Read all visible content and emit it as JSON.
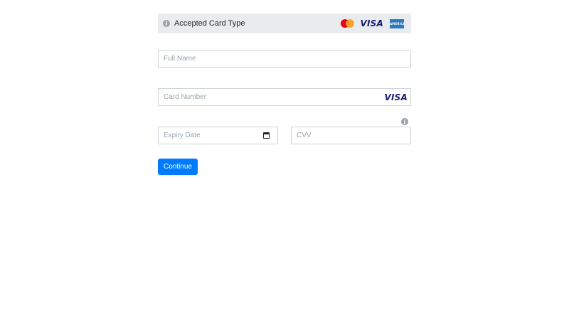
{
  "card_type_bar": {
    "label": "Accepted Card Type",
    "info_icon": "info-icon",
    "logos": {
      "mastercard": "mastercard-logo",
      "visa_text": "VISA",
      "amex_text": "AMERICAN EXPRESS"
    }
  },
  "form": {
    "full_name": {
      "placeholder": "Full Name",
      "value": ""
    },
    "card_number": {
      "placeholder": "Card Number",
      "value": "",
      "brand_text": "VISA"
    },
    "expiry_date": {
      "placeholder": "Expiry Date",
      "value": "",
      "icon": "calendar-icon"
    },
    "cvv": {
      "placeholder": "CVV",
      "value": "",
      "info_icon": "info-icon"
    },
    "continue_label": "Continue"
  },
  "colors": {
    "primary": "#007bff",
    "bar_background": "#e9ecef",
    "border": "#ced4da",
    "placeholder": "#9aa3ab",
    "visa_blue": "#1a1f71",
    "mastercard_red": "#eb001b",
    "mastercard_orange": "#f79e1b",
    "amex_blue": "#2e77bc"
  }
}
